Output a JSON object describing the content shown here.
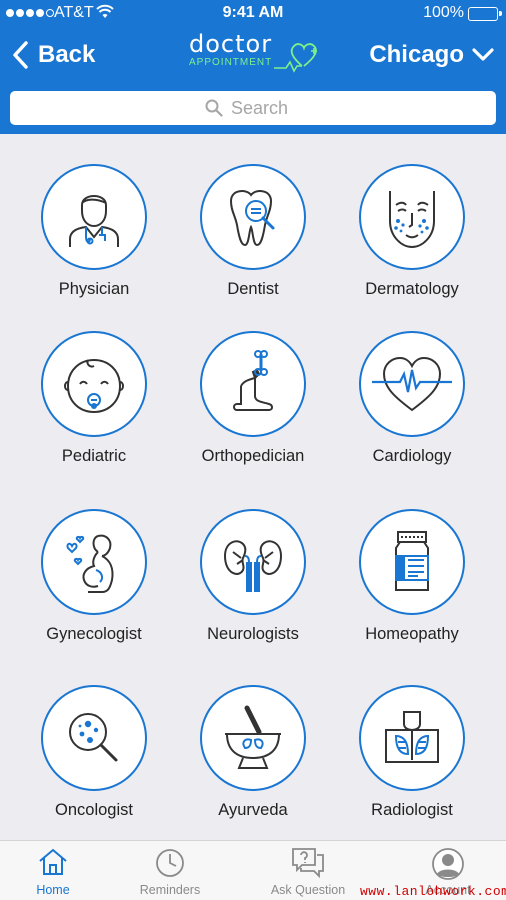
{
  "status_bar": {
    "carrier": "AT&T",
    "time": "9:41 AM",
    "battery": "100%"
  },
  "nav": {
    "back_label": "Back",
    "logo_word": "doctor",
    "logo_sub": "APPOINTMENT",
    "city": "Chicago"
  },
  "search": {
    "placeholder": "Search"
  },
  "categories": [
    {
      "label": "Physician",
      "icon": "physician-icon"
    },
    {
      "label": "Dentist",
      "icon": "dentist-icon"
    },
    {
      "label": "Dermatology",
      "icon": "dermatology-icon"
    },
    {
      "label": "Pediatric",
      "icon": "pediatric-icon"
    },
    {
      "label": "Orthopedician",
      "icon": "orthopedic-icon"
    },
    {
      "label": "Cardiology",
      "icon": "cardiology-icon"
    },
    {
      "label": "Gynecologist",
      "icon": "gynecology-icon"
    },
    {
      "label": "Neurologists",
      "icon": "kidney-icon"
    },
    {
      "label": "Homeopathy",
      "icon": "medicine-bottle-icon"
    },
    {
      "label": "Oncologist",
      "icon": "microscope-magnifier-icon"
    },
    {
      "label": "Ayurveda",
      "icon": "mortar-pestle-icon"
    },
    {
      "label": "Radiologist",
      "icon": "xray-icon"
    }
  ],
  "tabs": [
    {
      "label": "Home",
      "icon": "home-icon",
      "active": true
    },
    {
      "label": "Reminders",
      "icon": "clock-icon",
      "active": false
    },
    {
      "label": "Ask Question",
      "icon": "chat-question-icon",
      "active": false
    },
    {
      "label": "Account",
      "icon": "user-avatar-icon",
      "active": false
    }
  ],
  "watermark": "www.lanlohwork.com",
  "colors": {
    "primary": "#1976d2",
    "accent_green": "#7ef08a",
    "background": "#ececf1"
  }
}
